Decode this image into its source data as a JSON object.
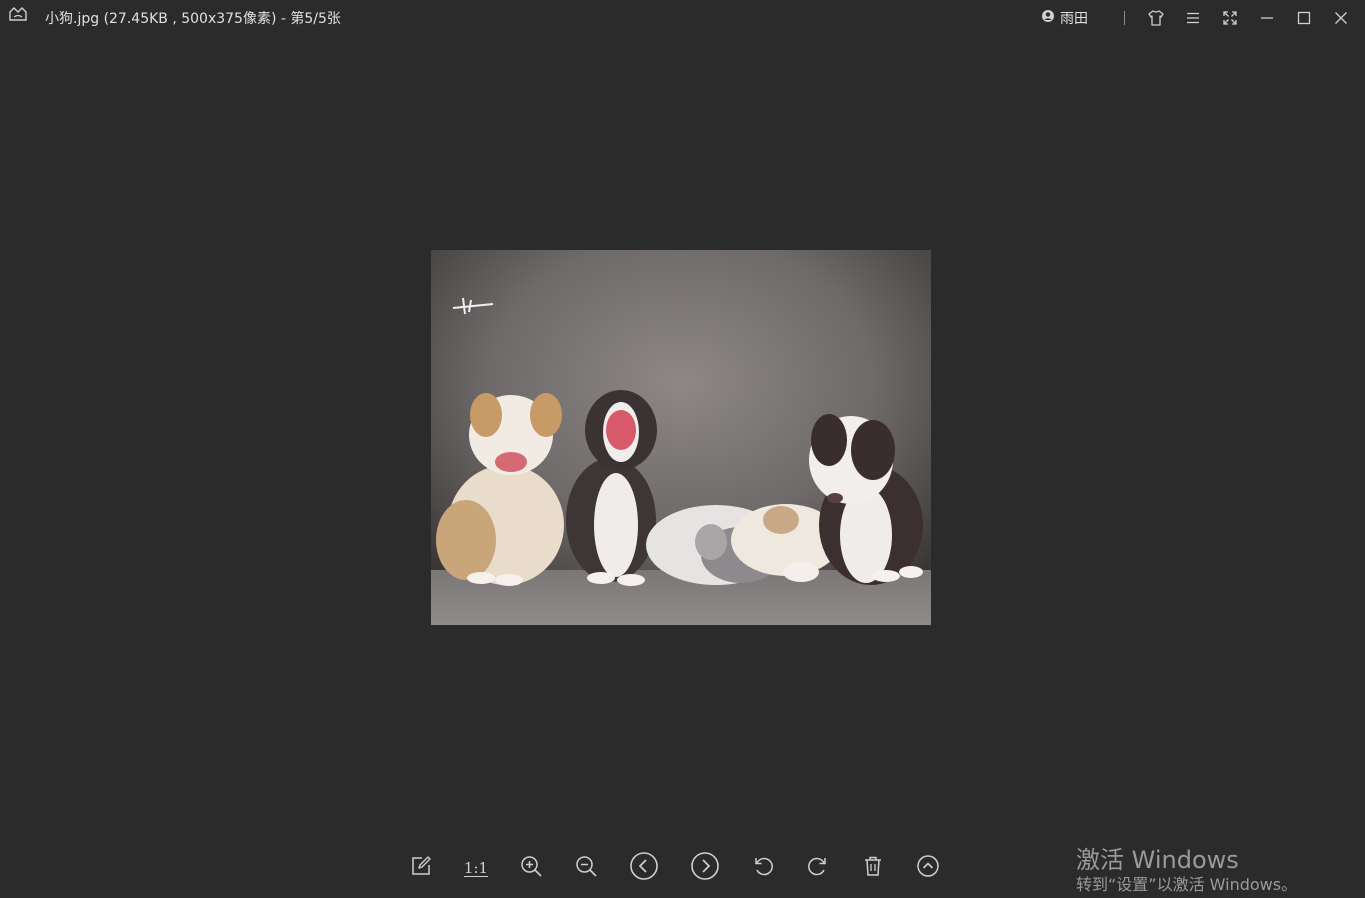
{
  "window": {
    "title": "小狗.jpg (27.45KB , 500x375像素) - 第5/5张"
  },
  "header": {
    "user_name": "雨田",
    "icons": [
      "app-logo-icon",
      "user-badge-icon",
      "skin-shirt-icon",
      "menu-icon",
      "fullscreen-icon",
      "minimize-icon",
      "maximize-icon",
      "close-icon"
    ]
  },
  "toolbar": {
    "ratio_label": "1:1",
    "buttons": [
      "edit-icon",
      "actual-size",
      "zoom-in-icon",
      "zoom-out-icon",
      "previous-icon",
      "next-icon",
      "rotate-left-icon",
      "rotate-right-icon",
      "delete-icon",
      "collapse-up-icon"
    ]
  },
  "watermark": {
    "title": "激活 Windows",
    "subtitle": "转到“设置”以激活 Windows。"
  },
  "colors": {
    "background": "#2b2b2b",
    "text": "#e0e0e0",
    "icon": "#cfcfcf"
  }
}
